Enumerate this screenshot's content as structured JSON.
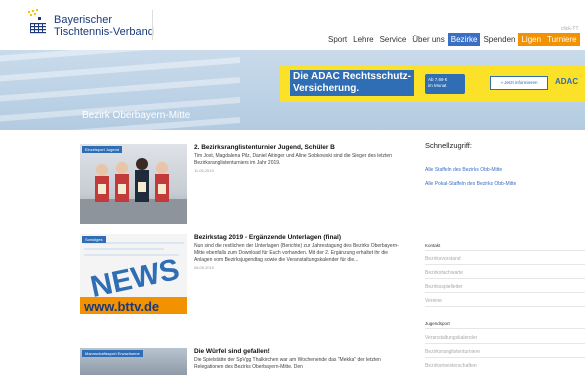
{
  "header": {
    "logo_line1": "Bayerischer",
    "logo_line2": "Tischtennis-Verband",
    "nav": [
      {
        "label": "Sport",
        "active": false
      },
      {
        "label": "Lehre",
        "active": false
      },
      {
        "label": "Service",
        "active": false
      },
      {
        "label": "Über uns",
        "active": false
      },
      {
        "label": "Bezirke",
        "active": true
      },
      {
        "label": "Spenden",
        "active": false
      },
      {
        "label": "Ligen",
        "active": false,
        "highlight": true
      },
      {
        "label": "Turniere",
        "active": false,
        "highlight": true
      }
    ],
    "click_hint": "click-TT"
  },
  "hero": {
    "ad_text_line1": "Die ADAC Rechtsschutz-",
    "ad_text_line2": "Versicherung.",
    "ad_price_line1": "Ab 7,69 €",
    "ad_price_line2": "im Monat",
    "ad_link": "» Jetzt informieren",
    "ad_brand": "ADAC",
    "title": "Bezirk Oberbayern-Mitte"
  },
  "articles": [
    {
      "tag": "Einzelsport Jugend",
      "title": "2. Bezirksranglistenturnier Jugend, Schüler B",
      "text": "Tim Jost, Magdalena Pilz, Daniel Aitinger und Aline Sobkowski sind die Sieger des letzten Bezirksranglistenturniers im Jahr 2019.",
      "date": "11.05.2019"
    },
    {
      "tag": "Sonstiges",
      "title": "Bezirkstag 2019 - Ergänzende Unterlagen (final)",
      "text": "Nun sind die restlichen der Unterlagen (Berichte) zur Jahrestagung des Bezirks Oberbayern-Mitte ebenfalls zum Download für Euch vorhanden. Mit der 2. Ergänzung erhaltet ihr die Anlagen vom Bezirksjugendtag sowie die Veranstaltungskalender für die...",
      "date": "08.05.2019",
      "thumb_text": "NEWS",
      "thumb_url": "www.bttv.de"
    },
    {
      "tag": "Mannschaftssport Erwachsene",
      "title": "Die Würfel sind gefallen!",
      "text": "Die Spielstätte der SpVgg Thalkirchen war am Wochenende das \"Mekka\" der letzten Relegationen des Bezirks Oberbayern-Mitte. Den",
      "date": ""
    }
  ],
  "sidebar": {
    "quick_title": "Schnellzugriff:",
    "quick_links": [
      "Alle Staffeln des Bezirks Obb-Mitte",
      "Alle Pokal-Staffeln des Bezirks Obb-Mitte"
    ],
    "section1_title": "Kontakt",
    "section1_items": [
      "Bezirksvorstand",
      "Bezirksfachwarte",
      "Bezirksspielleiter",
      "Vereine"
    ],
    "section2_title": "Jugendsport",
    "section2_items": [
      "Veranstaltungskalender",
      "Bezirksranglistenturniere",
      "Bezirksmeisterschaften"
    ]
  },
  "colors": {
    "brand_blue": "#3a6fc4",
    "accent_orange": "#f39200",
    "ad_yellow": "#fbe128"
  }
}
